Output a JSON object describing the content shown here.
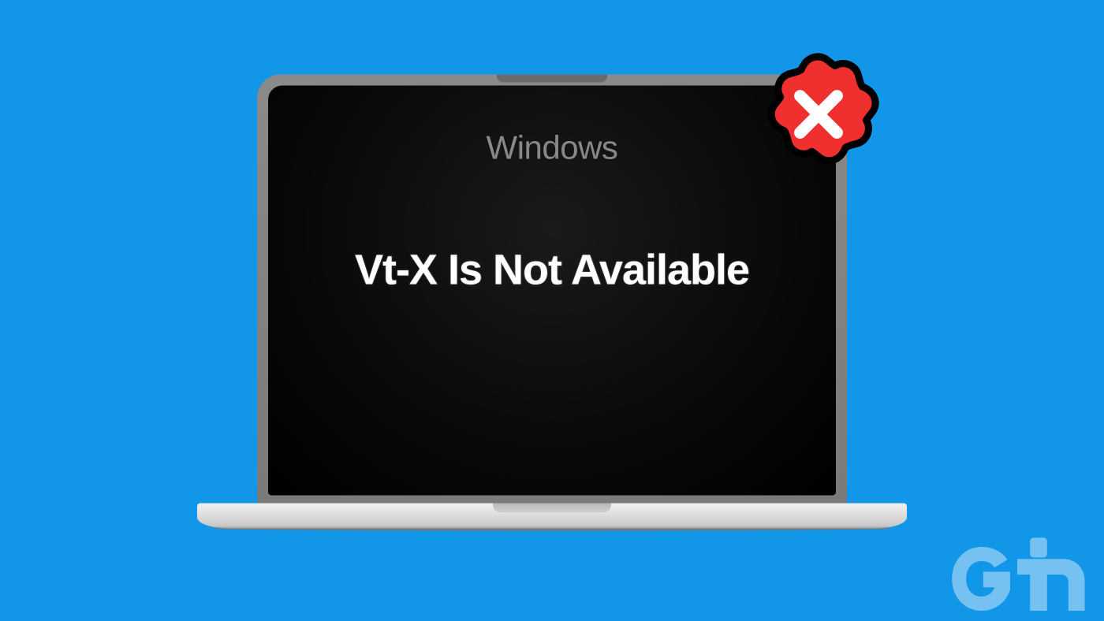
{
  "background_color": "#1296e8",
  "laptop": {
    "os_label": "Windows",
    "error_message": "Vt-X Is Not Available"
  },
  "badge": {
    "icon_name": "x-mark-icon",
    "color": "#f0302e",
    "stroke_color": "#000000"
  },
  "watermark": {
    "text": "Gt",
    "color": "rgba(255,255,255,0.4)"
  }
}
